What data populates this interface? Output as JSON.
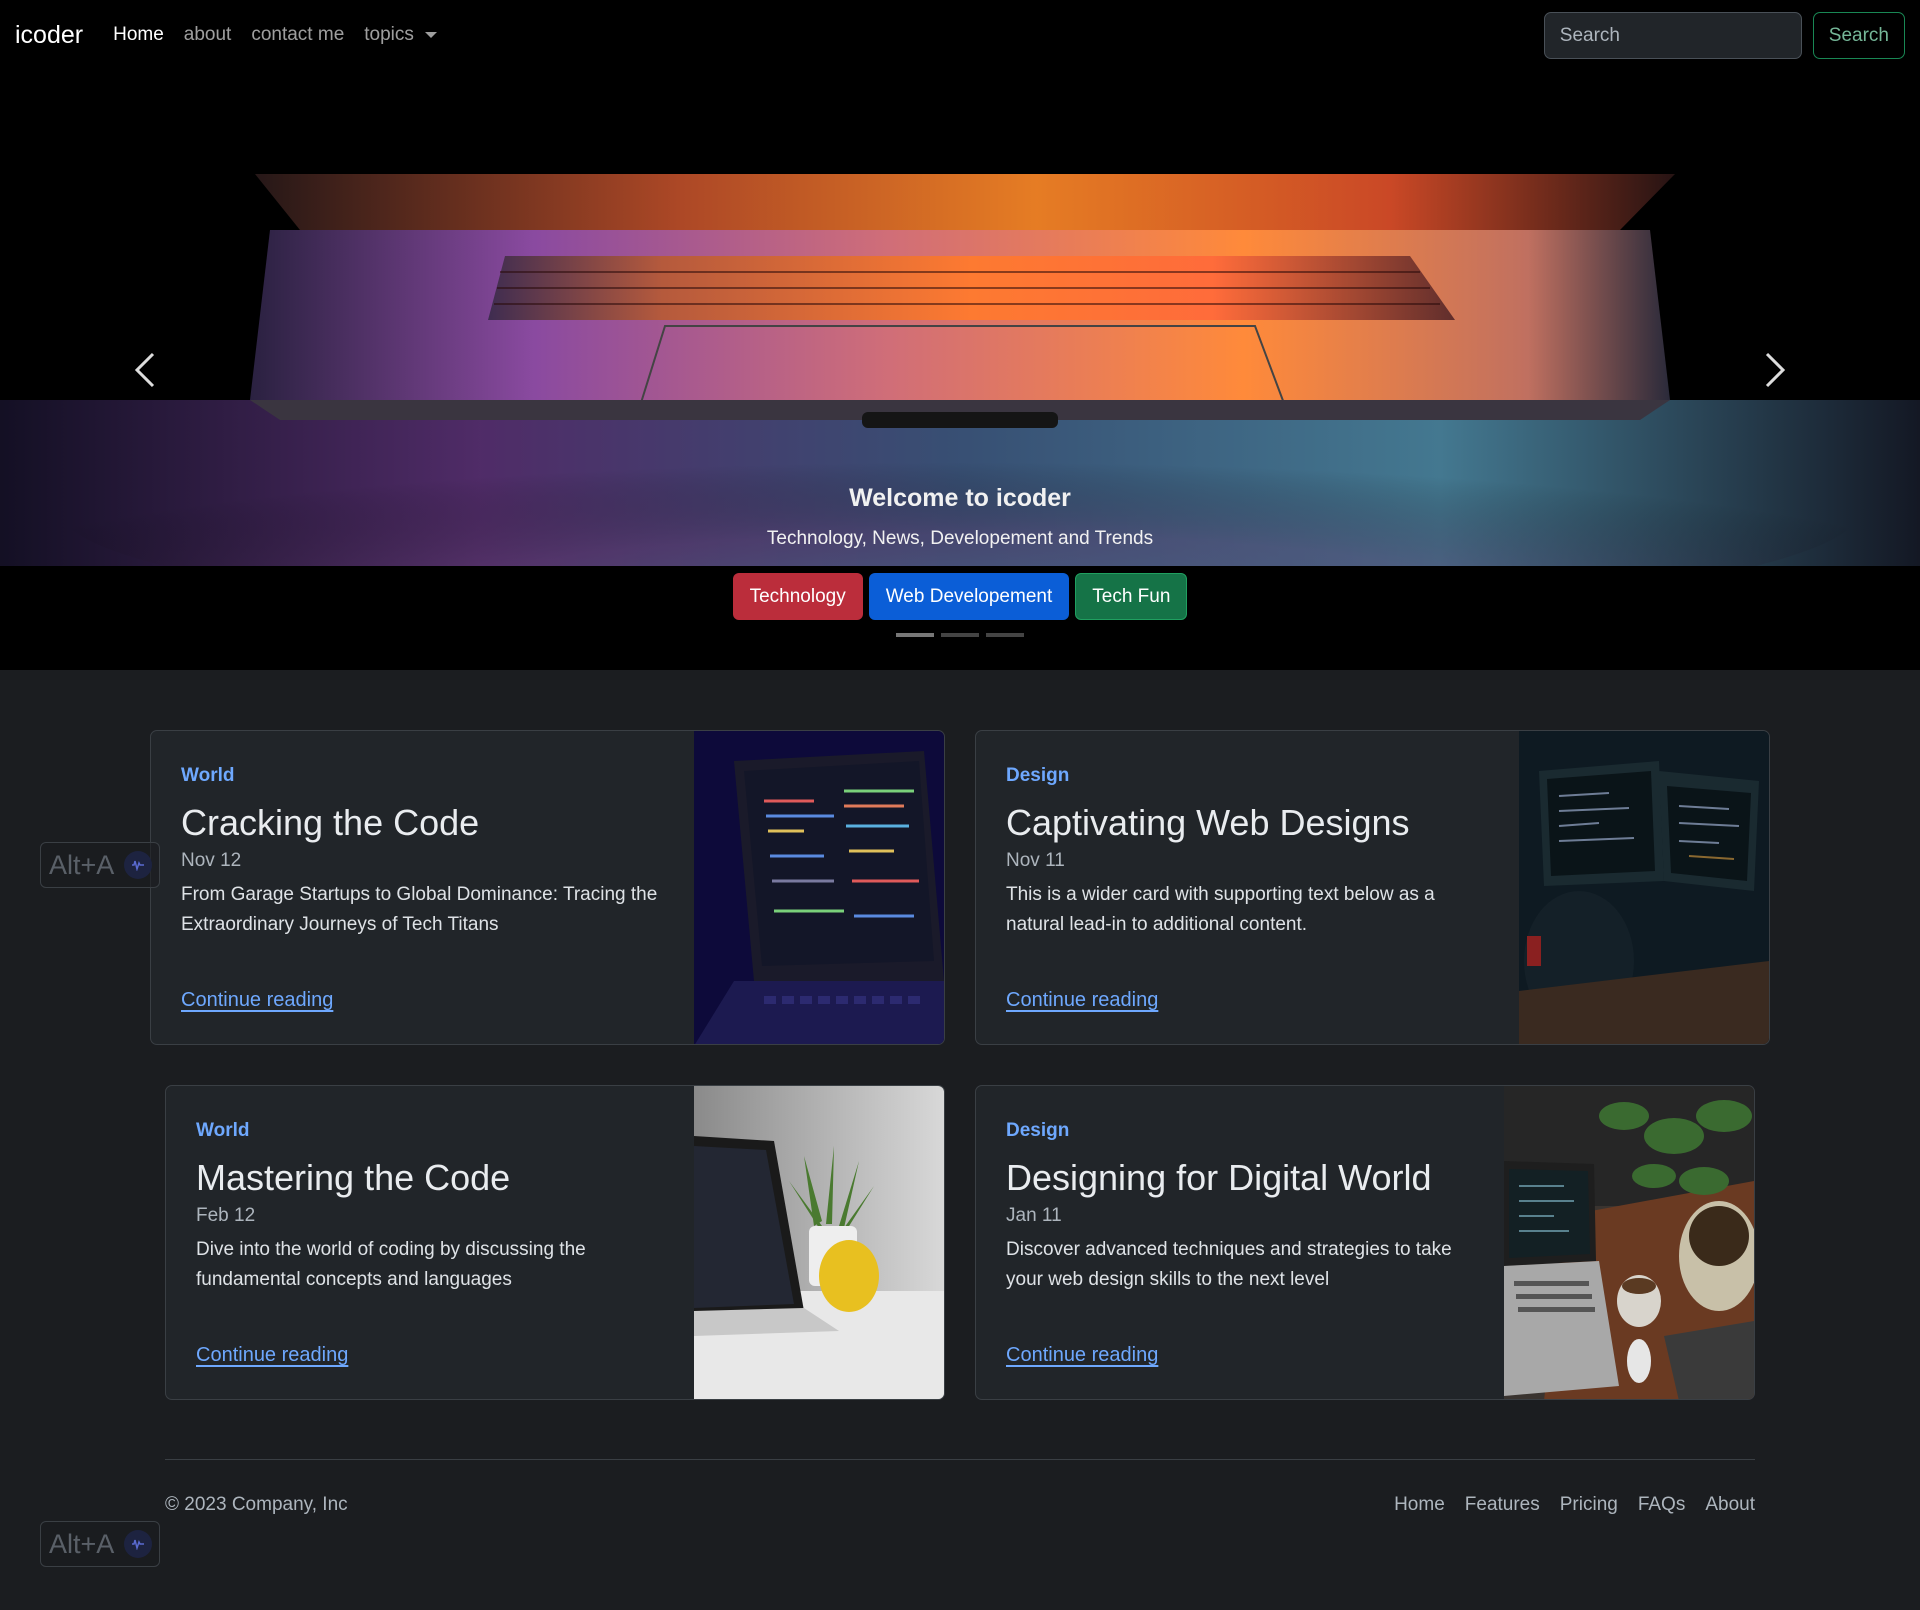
{
  "navbar": {
    "brand": "icoder",
    "links": [
      {
        "label": "Home"
      },
      {
        "label": "about"
      },
      {
        "label": "contact me"
      },
      {
        "label": "topics"
      }
    ],
    "search": {
      "placeholder": "Search",
      "button_label": "Search"
    }
  },
  "hero": {
    "title": "Welcome to icoder",
    "subtitle": "Technology, News, Developement and Trends",
    "buttons": [
      {
        "label": "Technology",
        "color": "#bb2d3b"
      },
      {
        "label": "Web Developement",
        "color": "#0b5ed7"
      },
      {
        "label": "Tech Fun",
        "color": "#157347"
      }
    ],
    "active_slide": 1,
    "slide_count": 3
  },
  "cards": [
    {
      "category": "World",
      "title": "Cracking the Code",
      "date": "Nov 12",
      "text": "From Garage Startups to Global Dominance: Tracing the Extraordinary Journeys of Tech Titans",
      "link": "Continue reading"
    },
    {
      "category": "Design",
      "title": "Captivating Web Designs",
      "date": "Nov 11",
      "text": "This is a wider card with supporting text below as a natural lead-in to additional content.",
      "link": "Continue reading"
    },
    {
      "category": "World",
      "title": "Mastering the Code",
      "date": "Feb 12",
      "text": "Dive into the world of coding by discussing the fundamental concepts and languages",
      "link": "Continue reading"
    },
    {
      "category": "Design",
      "title": "Designing for Digital World",
      "date": "Jan 11",
      "text": "Discover advanced techniques and strategies to take your web design skills to the next level",
      "link": "Continue reading"
    }
  ],
  "footer": {
    "copyright": "© 2023 Company, Inc",
    "links": [
      {
        "label": "Home"
      },
      {
        "label": "Features"
      },
      {
        "label": "Pricing"
      },
      {
        "label": "FAQs"
      },
      {
        "label": "About"
      }
    ]
  },
  "overlay": {
    "shortcut": "Alt+A"
  },
  "colors": {
    "accent_link": "#6ea8fe",
    "background": "#1b1d20",
    "card": "#212529"
  }
}
